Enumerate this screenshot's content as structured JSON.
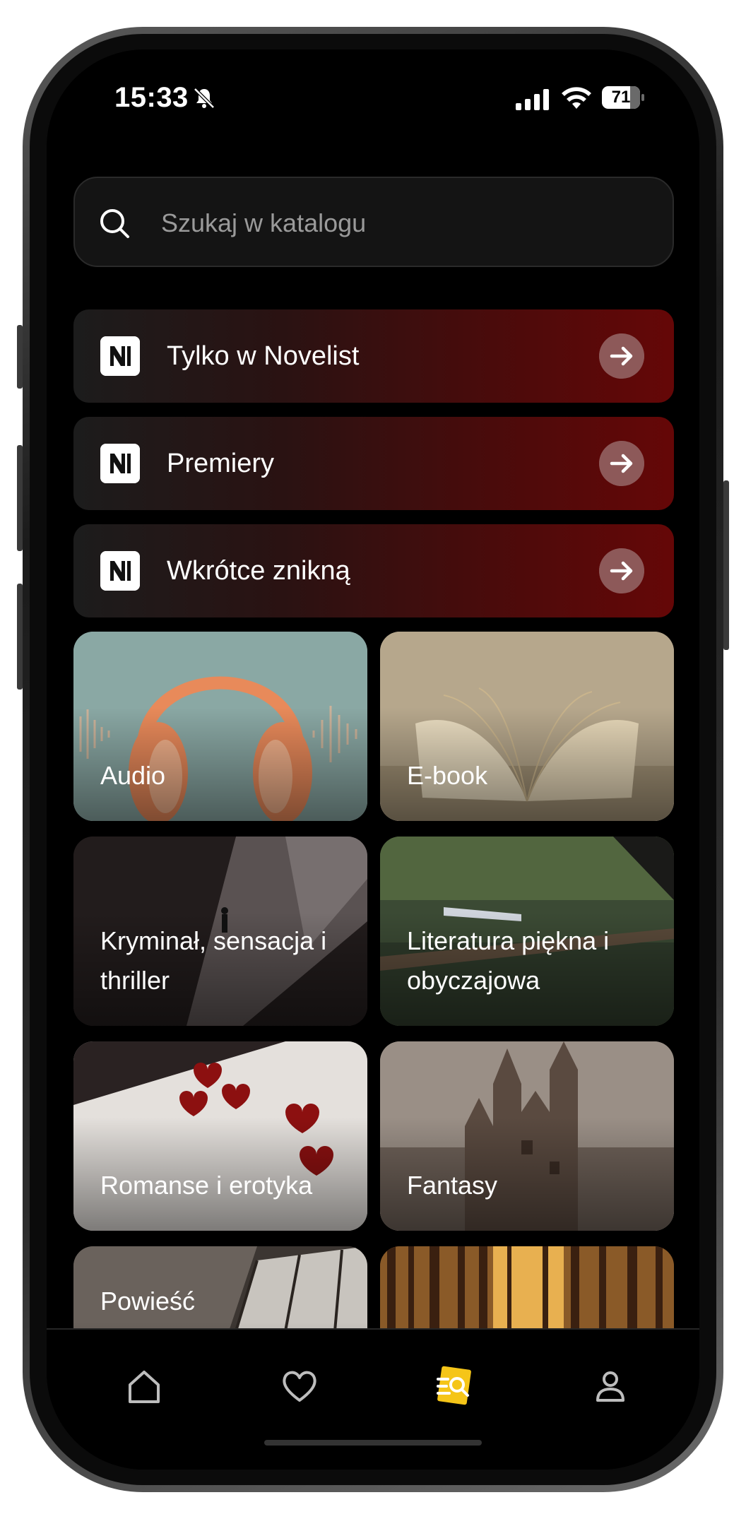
{
  "status_bar": {
    "time": "15:33",
    "battery": "71"
  },
  "search": {
    "placeholder": "Szukaj w katalogu"
  },
  "promos": [
    {
      "label": "Tylko w Novelist"
    },
    {
      "label": "Premiery"
    },
    {
      "label": "Wkrótce znikną"
    }
  ],
  "categories": [
    {
      "label": "Audio"
    },
    {
      "label": "E-book"
    },
    {
      "label": "Kryminał, sensacja i thriller"
    },
    {
      "label": "Literatura piękna i obyczajowa"
    },
    {
      "label": "Romanse i erotyka"
    },
    {
      "label": "Fantasy"
    },
    {
      "label": "Powieść"
    },
    {
      "label": ""
    }
  ],
  "bottom_nav": {
    "items": [
      {
        "icon": "home-icon"
      },
      {
        "icon": "heart-icon"
      },
      {
        "icon": "search-catalog-icon",
        "active": true
      },
      {
        "icon": "profile-icon"
      }
    ]
  },
  "colors": {
    "accent": "#f5c518",
    "promo_red": "#650707",
    "background": "#000000"
  }
}
